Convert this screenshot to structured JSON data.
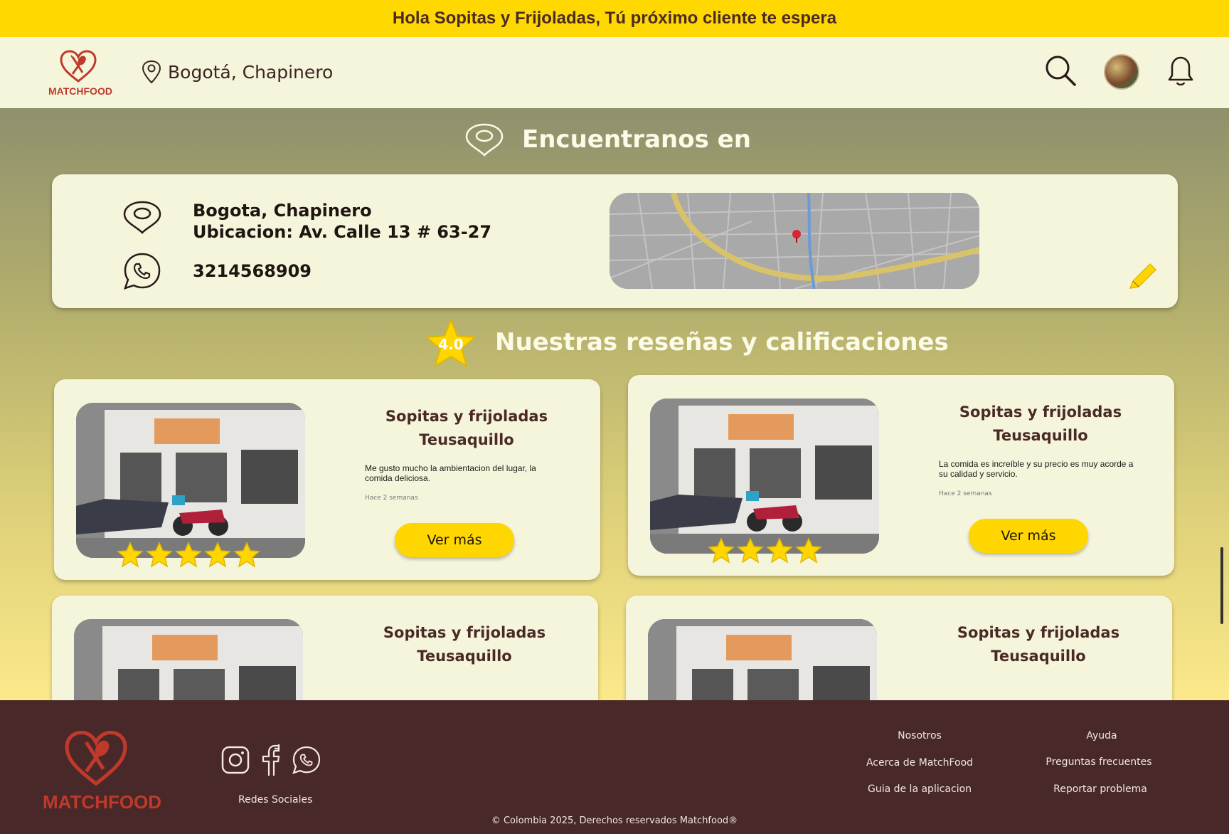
{
  "banner": {
    "text": "Hola Sopitas y Frijoladas, Tú próximo cliente te espera"
  },
  "header": {
    "logo_text": "MATCHFOOD",
    "location": "Bogotá, Chapinero",
    "icons": [
      "search-icon",
      "avatar",
      "bell-icon"
    ]
  },
  "find_section": {
    "title": "Encuentranos en",
    "address_line1": "Bogota, Chapinero",
    "address_line2": "Ubicacion: Av. Calle 13 # 63-27",
    "phone": "3214568909"
  },
  "reviews_section": {
    "title": "Nuestras reseñas y calificaciones",
    "rating": "4.0",
    "button_label": "Ver más",
    "cards": [
      {
        "name": "Sopitas y frijoladas Teusaquillo",
        "text": "Me gusto mucho la ambientacion del lugar, la comida deliciosa.",
        "time": "Hace 2 semanas",
        "stars": 5
      },
      {
        "name": "Sopitas y frijoladas Teusaquillo",
        "text": "La comida es increíble y su precio es muy acorde a su calidad y servicio.",
        "time": "Hace 2 semanas",
        "stars": 4
      },
      {
        "name": "Sopitas y frijoladas Teusaquillo"
      },
      {
        "name": "Sopitas y frijoladas Teusaquillo"
      }
    ]
  },
  "footer": {
    "logo_text": "MATCHFOOD",
    "social_label": "Redes Sociales",
    "col1": [
      "Nosotros",
      "Acerca de MatchFood",
      "Guia de la aplicacion"
    ],
    "col2": [
      "Ayuda",
      "Preguntas frecuentes",
      "Reportar problema"
    ],
    "copyright": "© Colombia 2025, Derechos reservados Matchfood®"
  },
  "colors": {
    "accent": "#ffd800",
    "brand_red": "#c0392b",
    "dark": "#482828",
    "cream": "#f5f5dc"
  }
}
